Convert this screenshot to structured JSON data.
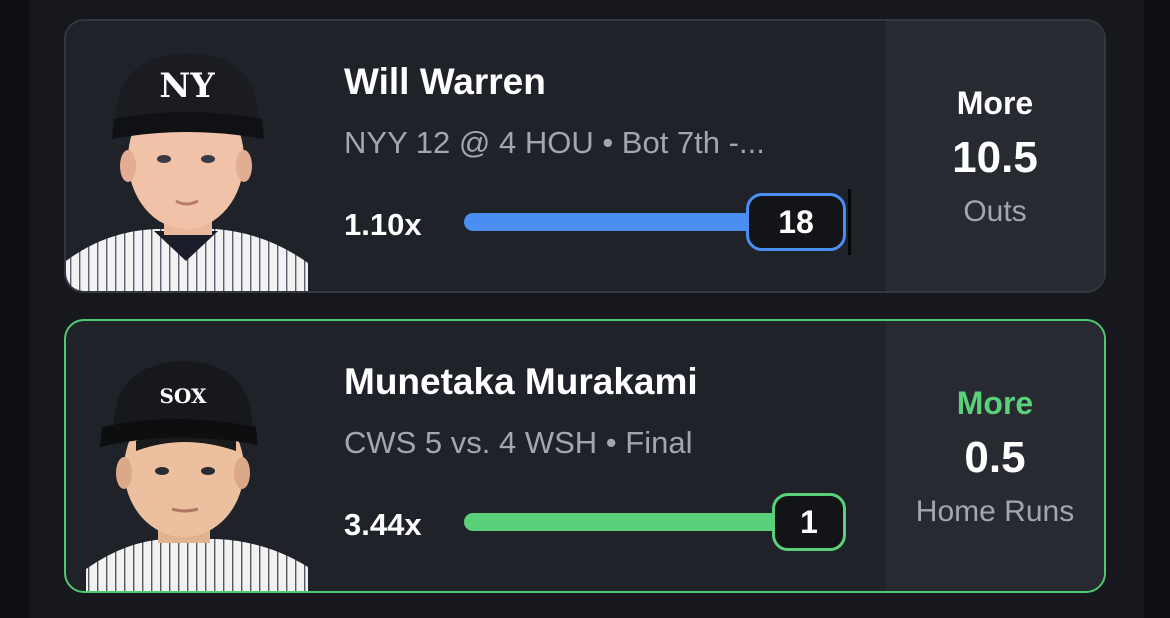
{
  "picks": [
    {
      "player_name": "Will Warren",
      "game_info": "NYY 12 @ 4 HOU • Bot 7th  -...",
      "multiplier": "1.10x",
      "current_value": "18",
      "progress_fraction": 1.0,
      "direction": "More",
      "line": "10.5",
      "stat": "Outs",
      "accent_color": "#4b8ef1",
      "team_logo_text": "NY",
      "headshot_icon": "yankees-player-headshot"
    },
    {
      "player_name": "Munetaka Murakami",
      "game_info": "CWS 5 vs. 4 WSH • Final",
      "multiplier": "3.44x",
      "current_value": "1",
      "progress_fraction": 1.0,
      "direction": "More",
      "line": "0.5",
      "stat": "Home Runs",
      "accent_color": "#5bd07a",
      "team_logo_text": "SOX",
      "headshot_icon": "white-sox-player-headshot"
    }
  ]
}
